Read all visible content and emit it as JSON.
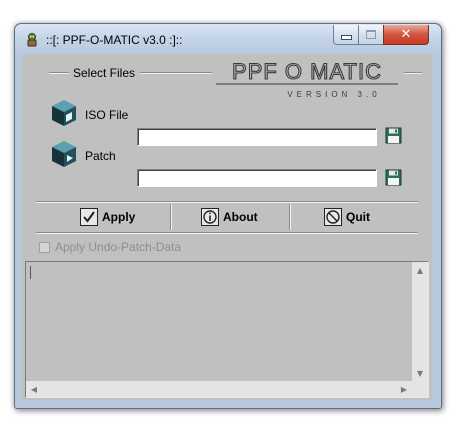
{
  "window": {
    "title": "::[: PPF-O-MATIC v3.0 :]::"
  },
  "select_files": {
    "group_label": "Select Files",
    "logo_text": "PPF O MATIC",
    "logo_subtext": "VERSION 3.0",
    "iso_label": "ISO File",
    "iso_value": "",
    "patch_label": "Patch",
    "patch_value": ""
  },
  "actions": {
    "apply_label": "Apply",
    "about_label": "About",
    "quit_label": "Quit"
  },
  "options": {
    "undo_patch_label": "Apply Undo-Patch-Data",
    "undo_patch_checked": false,
    "undo_patch_enabled": false
  },
  "log": {
    "text": ""
  },
  "colors": {
    "client_bg": "#c0c0c0",
    "titlebar": "#c3d3e7",
    "close_button": "#c43b22"
  },
  "icons": {
    "app": "mascot-icon",
    "iso": "cube-icon",
    "patch": "cube-arrow-icon",
    "browse": "floppy-disk-icon",
    "apply": "checkmark-icon",
    "about": "info-icon",
    "quit": "no-entry-icon"
  }
}
